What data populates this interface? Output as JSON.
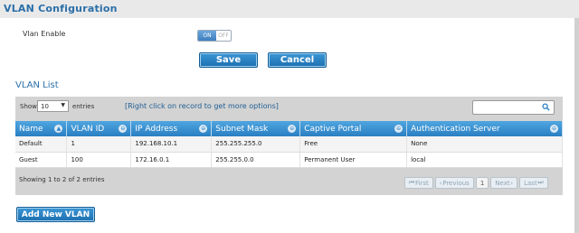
{
  "page": {
    "title": "VLAN Configuration"
  },
  "vlan_enable": {
    "label": "Vlan Enable",
    "on_label": "ON",
    "off_label": "OFF"
  },
  "buttons": {
    "save": "Save",
    "cancel": "Cancel",
    "add_new": "Add New VLAN"
  },
  "vlan_list": {
    "title": "VLAN List",
    "show_label": "Show",
    "show_value": "10",
    "entries_label": "entries",
    "hint": "[Right click on record to get more options]",
    "search_value": ""
  },
  "table": {
    "columns": [
      "Name",
      "VLAN ID",
      "IP Address",
      "Subnet Mask",
      "Captive Portal",
      "Authentication Server"
    ],
    "rows": [
      [
        "Default",
        "1",
        "192.168.10.1",
        "255.255.255.0",
        "Free",
        "None"
      ],
      [
        "Guest",
        "100",
        "172.16.0.1",
        "255.255.0.0",
        "Permanent User",
        "local"
      ]
    ]
  },
  "footer": {
    "showing": "Showing 1 to 2 of 2 entries",
    "first": "First",
    "previous": "Previous",
    "page": "1",
    "next": "Next",
    "last": "Last"
  },
  "colors": {
    "accent": "#2b6fa8",
    "header_blue": "#2a7fc2"
  }
}
